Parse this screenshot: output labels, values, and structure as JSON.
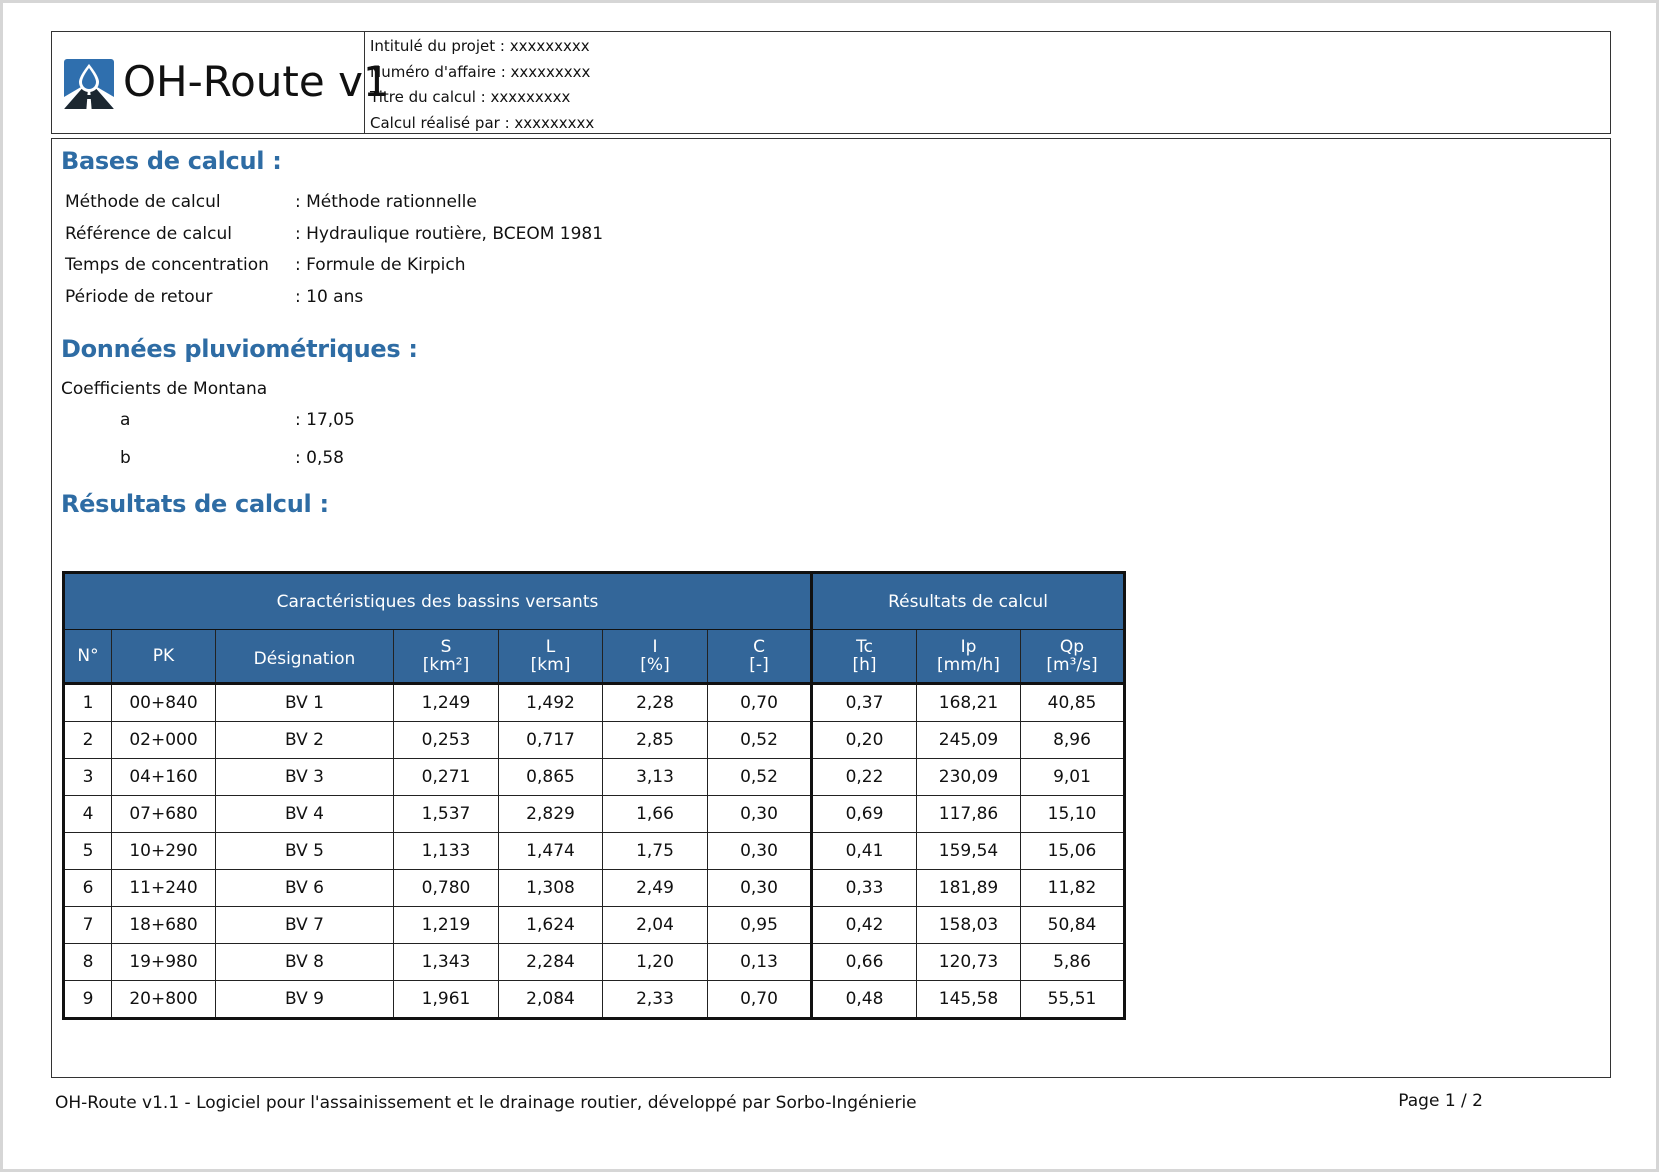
{
  "header": {
    "app_title": "OH-Route v1",
    "project_title": "Intitulé du projet : xxxxxxxxx",
    "case_number": "Numéro d'affaire : xxxxxxxxx",
    "calc_title": "Titre du calcul : xxxxxxxxx",
    "calc_by": "Calcul réalisé par : xxxxxxxxx"
  },
  "bases": {
    "title": "Bases de calcul :",
    "rows": [
      {
        "key": "Méthode de calcul",
        "value": ": Méthode rationnelle"
      },
      {
        "key": "Référence de calcul",
        "value": ": Hydraulique routière, BCEOM 1981"
      },
      {
        "key": "Temps de concentration",
        "value": ": Formule de Kirpich"
      },
      {
        "key": "Période de retour",
        "value": ": 10 ans"
      }
    ]
  },
  "rain": {
    "title": "Données pluviométriques :",
    "subtitle": "Coefficients de Montana",
    "coefficients": [
      {
        "key": "a",
        "value": ": 17,05"
      },
      {
        "key": "b",
        "value": ": 0,58"
      }
    ]
  },
  "results": {
    "title": "Résultats de calcul :",
    "group_headers": [
      "Caractéristiques des bassins versants",
      "Résultats de calcul"
    ],
    "columns": [
      {
        "name": "N°",
        "unit": ""
      },
      {
        "name": "PK",
        "unit": ""
      },
      {
        "name": "Désignation",
        "unit": ""
      },
      {
        "name": "S",
        "unit": "[km²]"
      },
      {
        "name": "L",
        "unit": "[km]"
      },
      {
        "name": "I",
        "unit": "[%]"
      },
      {
        "name": "C",
        "unit": "[-]"
      },
      {
        "name": "Tc",
        "unit": "[h]"
      },
      {
        "name": "Ip",
        "unit": "[mm/h]"
      },
      {
        "name": "Qp",
        "unit": "[m³/s]"
      }
    ],
    "rows": [
      [
        "1",
        "00+840",
        "BV 1",
        "1,249",
        "1,492",
        "2,28",
        "0,70",
        "0,37",
        "168,21",
        "40,85"
      ],
      [
        "2",
        "02+000",
        "BV 2",
        "0,253",
        "0,717",
        "2,85",
        "0,52",
        "0,20",
        "245,09",
        "8,96"
      ],
      [
        "3",
        "04+160",
        "BV 3",
        "0,271",
        "0,865",
        "3,13",
        "0,52",
        "0,22",
        "230,09",
        "9,01"
      ],
      [
        "4",
        "07+680",
        "BV 4",
        "1,537",
        "2,829",
        "1,66",
        "0,30",
        "0,69",
        "117,86",
        "15,10"
      ],
      [
        "5",
        "10+290",
        "BV 5",
        "1,133",
        "1,474",
        "1,75",
        "0,30",
        "0,41",
        "159,54",
        "15,06"
      ],
      [
        "6",
        "11+240",
        "BV 6",
        "0,780",
        "1,308",
        "2,49",
        "0,30",
        "0,33",
        "181,89",
        "11,82"
      ],
      [
        "7",
        "18+680",
        "BV 7",
        "1,219",
        "1,624",
        "2,04",
        "0,95",
        "0,42",
        "158,03",
        "50,84"
      ],
      [
        "8",
        "19+980",
        "BV 8",
        "1,343",
        "2,284",
        "1,20",
        "0,13",
        "0,66",
        "120,73",
        "5,86"
      ],
      [
        "9",
        "20+800",
        "BV 9",
        "1,961",
        "2,084",
        "2,33",
        "0,70",
        "0,48",
        "145,58",
        "55,51"
      ]
    ]
  },
  "footer": {
    "text": "OH-Route v1.1 - Logiciel pour l'assainissement et le drainage routier, développé par Sorbo-Ingénierie",
    "page": "Page 1 / 2"
  },
  "colors": {
    "accent": "#2e6ca4",
    "table_header": "#336699"
  },
  "icons": {
    "logo": "water-drop-road-logo-icon"
  }
}
